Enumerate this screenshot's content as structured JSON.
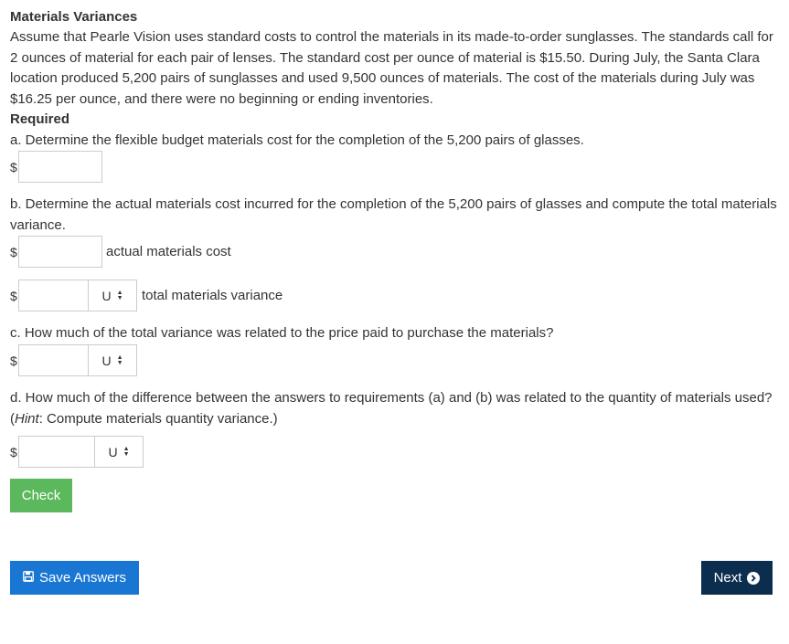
{
  "title": "Materials Variances",
  "intro": "Assume that Pearle Vision uses standard costs to control the materials in its made-to-order sunglasses. The standards call for 2 ounces of material for each pair of lenses. The standard cost per ounce of material is $15.50. During July, the Santa Clara location produced 5,200 pairs of sunglasses and used 9,500 ounces of materials. The cost of the materials during July was $16.25 per ounce, and there were no beginning or ending inventories.",
  "required_label": "Required",
  "qa": {
    "text": "a. Determine the flexible budget materials cost for the completion of the 5,200 pairs of glasses.",
    "currency": "$",
    "value": ""
  },
  "qb": {
    "text": "b. Determine the actual materials cost incurred for the completion of the 5,200 pairs of glasses and compute the total materials variance.",
    "currency": "$",
    "actual_value": "",
    "actual_label": "actual materials cost",
    "variance_value": "",
    "variance_select": "U",
    "variance_label": "total materials variance"
  },
  "qc": {
    "text": "c. How much of the total variance was related to the price paid to purchase the materials?",
    "currency": "$",
    "value": "",
    "select": "U"
  },
  "qd": {
    "text_before_hint": "d. How much of the difference between the answers to requirements (a) and (b) was related to the quantity of materials used? (",
    "hint_label": "Hint",
    "text_after_hint": ": Compute materials quantity variance.)",
    "currency": "$",
    "value": "",
    "select": "U"
  },
  "buttons": {
    "check": "Check",
    "save": "Save Answers",
    "next": "Next"
  },
  "icons": {
    "save": "floppy-disk-icon",
    "next": "chevron-circle-right-icon",
    "select": "up-down-arrows-icon"
  },
  "colors": {
    "check_button": "#5cb85c",
    "save_button": "#1976d2",
    "next_button": "#0b2d4e",
    "text": "#333333"
  }
}
